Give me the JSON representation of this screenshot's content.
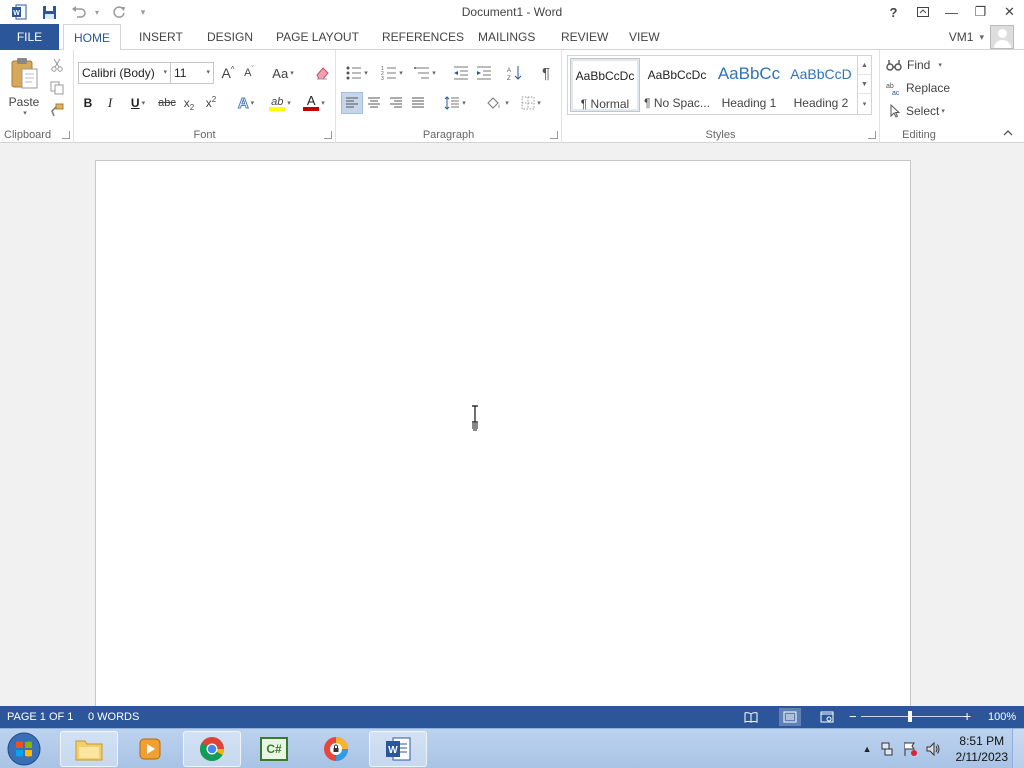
{
  "window": {
    "title": "Document1 - Word",
    "help": "?",
    "restore_ribbon": "⧉",
    "minimize": "—",
    "maximize": "❐",
    "close": "✕"
  },
  "qat": {
    "customize": "▾"
  },
  "tabs": [
    {
      "label": "FILE"
    },
    {
      "label": "HOME"
    },
    {
      "label": "INSERT"
    },
    {
      "label": "DESIGN"
    },
    {
      "label": "PAGE LAYOUT"
    },
    {
      "label": "REFERENCES"
    },
    {
      "label": "MAILINGS"
    },
    {
      "label": "REVIEW"
    },
    {
      "label": "VIEW"
    }
  ],
  "account": {
    "user": "VM1",
    "arrow": "▾"
  },
  "ribbon": {
    "clipboard": {
      "label": "Clipboard",
      "paste": "Paste"
    },
    "font": {
      "label": "Font",
      "family": "Calibri (Body)",
      "size": "11",
      "grow": "A",
      "shrink": "A",
      "case": "Aa",
      "bold": "B",
      "italic": "I",
      "underline": "U",
      "strike": "abc",
      "sub": "x",
      "sup": "x",
      "effects": "A",
      "highlight": "ab",
      "color": "A"
    },
    "paragraph": {
      "label": "Paragraph",
      "pilcrow": "¶"
    },
    "styles": {
      "label": "Styles",
      "items": [
        {
          "sample": "AaBbCcDc",
          "name": "¶ Normal"
        },
        {
          "sample": "AaBbCcDc",
          "name": "¶ No Spac..."
        },
        {
          "sample": "AaBbCc",
          "name": "Heading 1"
        },
        {
          "sample": "AaBbCcD",
          "name": "Heading 2"
        }
      ]
    },
    "editing": {
      "label": "Editing",
      "find": "Find",
      "replace": "Replace",
      "select": "Select"
    }
  },
  "status": {
    "page": "PAGE 1 OF 1",
    "words": "0 WORDS",
    "zoom": "100%",
    "zoom_minus": "−",
    "zoom_plus": "+",
    "zoom_level": 1.0
  },
  "taskbar": {
    "time": "8:51 PM",
    "date": "2/11/2023",
    "csharp_label": "C#"
  },
  "colors": {
    "word_blue": "#2b579a",
    "accent_red": "#c00000",
    "highlight_yellow": "#ffff00"
  }
}
